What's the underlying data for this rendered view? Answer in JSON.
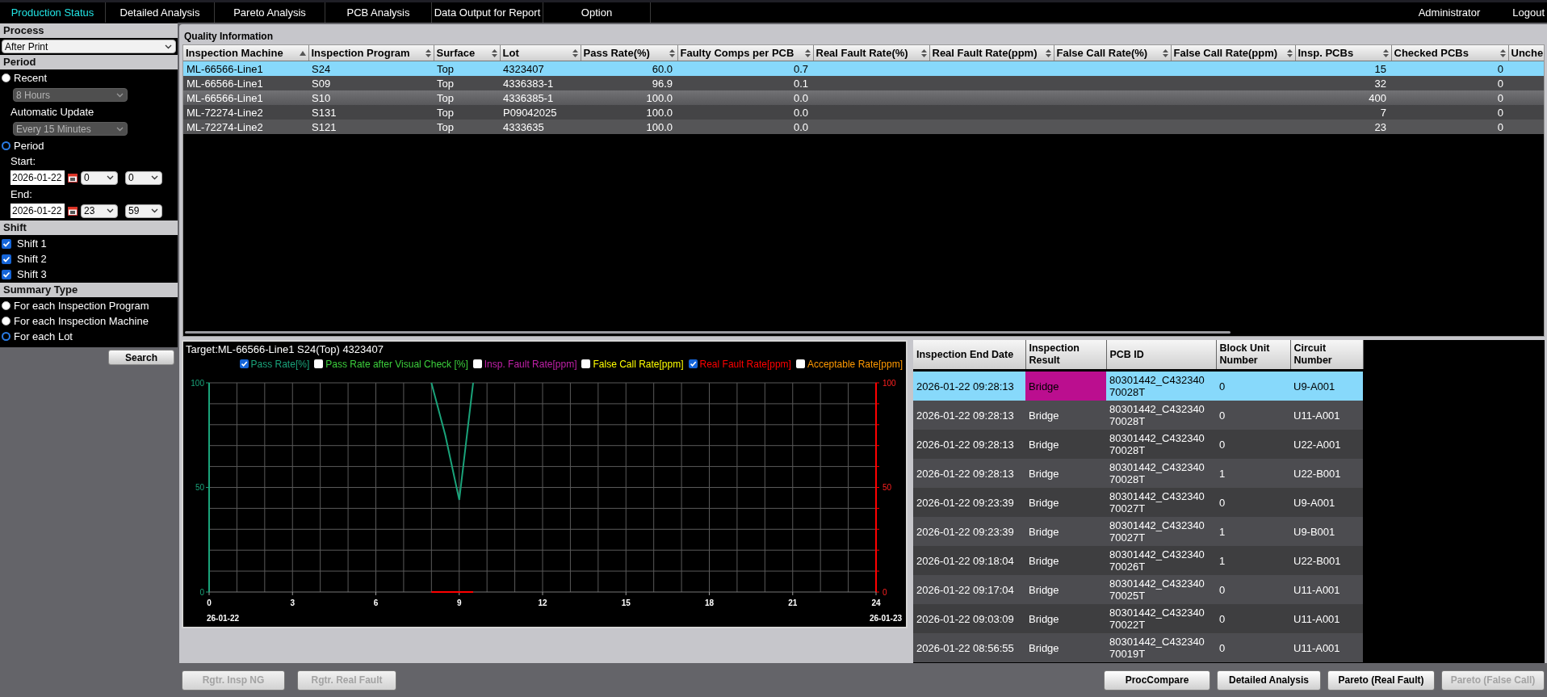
{
  "nav": {
    "tabs": [
      {
        "label": "Production Status",
        "selected": true
      },
      {
        "label": "Detailed Analysis",
        "selected": false
      },
      {
        "label": "Pareto Analysis",
        "selected": false
      },
      {
        "label": "PCB Analysis",
        "selected": false
      },
      {
        "label": "Data Output for Report",
        "selected": false
      },
      {
        "label": "Option",
        "selected": false
      }
    ],
    "user": "Administrator",
    "logout": "Logout"
  },
  "sidebar": {
    "process": {
      "heading": "Process",
      "value": "After Print"
    },
    "period": {
      "heading": "Period",
      "recent": {
        "label": "Recent",
        "selected": false,
        "range": {
          "value": "8 Hours",
          "disabled": true
        },
        "update_label": "Automatic Update",
        "update": {
          "value": "Every 15 Minutes",
          "disabled": true
        }
      },
      "custom": {
        "label": "Period",
        "selected": true,
        "start_label": "Start:",
        "start": {
          "date": "2026-01-22",
          "hour": "0",
          "minute": "0"
        },
        "end_label": "End:",
        "end": {
          "date": "2026-01-22",
          "hour": "23",
          "minute": "59"
        }
      }
    },
    "shift": {
      "heading": "Shift",
      "items": [
        {
          "label": "Shift 1",
          "checked": true
        },
        {
          "label": "Shift 2",
          "checked": true
        },
        {
          "label": "Shift 3",
          "checked": true
        }
      ]
    },
    "summary_type": {
      "heading": "Summary Type",
      "options": [
        {
          "label": "For each Inspection Program",
          "selected": false
        },
        {
          "label": "For each Inspection Machine",
          "selected": false
        },
        {
          "label": "For each Lot",
          "selected": true
        }
      ]
    },
    "search_button": "Search"
  },
  "quality": {
    "title": "Quality Information",
    "columns": [
      {
        "label": "Inspection Machine",
        "sorted": true
      },
      {
        "label": "Inspection Program",
        "sorted": false
      },
      {
        "label": "Surface",
        "sorted": false
      },
      {
        "label": "Lot",
        "sorted": false
      },
      {
        "label": "Pass Rate(%)",
        "sorted": false
      },
      {
        "label": "Faulty Comps per PCB",
        "sorted": false
      },
      {
        "label": "Real Fault Rate(%)",
        "sorted": false
      },
      {
        "label": "Real Fault Rate(ppm)",
        "sorted": false
      },
      {
        "label": "False Call Rate(%)",
        "sorted": false
      },
      {
        "label": "False Call Rate(ppm)",
        "sorted": false
      },
      {
        "label": "Insp. PCBs",
        "sorted": false
      },
      {
        "label": "Checked PCBs",
        "sorted": false
      },
      {
        "label": "Unche"
      }
    ],
    "rows": [
      {
        "selected": true,
        "cells": [
          "ML-66566-Line1",
          "S24",
          "Top",
          "4323407",
          "60.0",
          "0.7",
          null,
          null,
          null,
          null,
          "15",
          "0",
          null
        ]
      },
      {
        "selected": false,
        "cells": [
          "ML-66566-Line1",
          "S09",
          "Top",
          "4336383-1",
          "96.9",
          "0.1",
          null,
          null,
          null,
          null,
          "32",
          "0",
          null
        ]
      },
      {
        "selected": false,
        "cells": [
          "ML-66566-Line1",
          "S10",
          "Top",
          "4336385-1",
          "100.0",
          "0.0",
          null,
          null,
          null,
          null,
          "400",
          "0",
          null
        ]
      },
      {
        "selected": false,
        "cells": [
          "ML-72274-Line2",
          "S131",
          "Top",
          "P09042025",
          "100.0",
          "0.0",
          null,
          null,
          null,
          null,
          "7",
          "0",
          null
        ]
      },
      {
        "selected": false,
        "cells": [
          "ML-72274-Line2",
          "S121",
          "Top",
          "4333635",
          "100.0",
          "0.0",
          null,
          null,
          null,
          null,
          "23",
          "0",
          null
        ]
      }
    ]
  },
  "chart": {
    "title": "Target:ML-66566-Line1 S24(Top) 4323407",
    "legend": [
      {
        "label": "Pass Rate[%]",
        "checked": true,
        "color": "#1aa37a"
      },
      {
        "label": "Pass Rate after Visual Check [%]",
        "checked": false,
        "color": "#3ccf3c"
      },
      {
        "label": "Insp. Fault Rate[ppm]",
        "checked": false,
        "color": "#c020a8"
      },
      {
        "label": "False Call Rate[ppm]",
        "checked": false,
        "color": "#ffff00"
      },
      {
        "label": "Real Fault Rate[ppm]",
        "checked": true,
        "color": "#ff0000"
      },
      {
        "label": "Acceptable Rate[ppm]",
        "checked": false,
        "color": "#ff9900"
      }
    ],
    "start_date": "26-01-22",
    "end_date": "26-01-23",
    "chart_data": {
      "type": "line",
      "x": [
        8,
        8.5,
        9,
        9.5
      ],
      "series": [
        {
          "color": "#1aa37a",
          "values": [
            100,
            75,
            44,
            100
          ]
        },
        {
          "color": "#ff0000",
          "values": [
            0,
            0,
            0,
            0
          ]
        }
      ],
      "xlim": [
        0,
        24
      ],
      "ylim": [
        0,
        100
      ],
      "y2lim": [
        0,
        100
      ],
      "grid": true,
      "xticks": [
        0,
        3,
        6,
        9,
        12,
        15,
        18,
        21,
        24
      ],
      "yticks": [
        0,
        50,
        100
      ],
      "y2ticks": [
        0,
        50,
        100
      ]
    }
  },
  "defects": {
    "columns": [
      "Inspection End Date",
      "Inspection Result",
      "PCB ID",
      "Block Unit Number",
      "Circuit Number"
    ],
    "rows": [
      {
        "selected": true,
        "date": "2026-01-22 09:28:13",
        "result": "Bridge",
        "pcb_id": "80301442_C43234070028T",
        "block": "0",
        "circuit": "U9-A001"
      },
      {
        "selected": false,
        "date": "2026-01-22 09:28:13",
        "result": "Bridge",
        "pcb_id": "80301442_C43234070028T",
        "block": "0",
        "circuit": "U11-A001"
      },
      {
        "selected": false,
        "date": "2026-01-22 09:28:13",
        "result": "Bridge",
        "pcb_id": "80301442_C43234070028T",
        "block": "0",
        "circuit": "U22-A001"
      },
      {
        "selected": false,
        "date": "2026-01-22 09:28:13",
        "result": "Bridge",
        "pcb_id": "80301442_C43234070028T",
        "block": "1",
        "circuit": "U22-B001"
      },
      {
        "selected": false,
        "date": "2026-01-22 09:23:39",
        "result": "Bridge",
        "pcb_id": "80301442_C43234070027T",
        "block": "0",
        "circuit": "U9-A001"
      },
      {
        "selected": false,
        "date": "2026-01-22 09:23:39",
        "result": "Bridge",
        "pcb_id": "80301442_C43234070027T",
        "block": "1",
        "circuit": "U9-B001"
      },
      {
        "selected": false,
        "date": "2026-01-22 09:18:04",
        "result": "Bridge",
        "pcb_id": "80301442_C43234070026T",
        "block": "1",
        "circuit": "U22-B001"
      },
      {
        "selected": false,
        "date": "2026-01-22 09:17:04",
        "result": "Bridge",
        "pcb_id": "80301442_C43234070025T",
        "block": "0",
        "circuit": "U11-A001"
      },
      {
        "selected": false,
        "date": "2026-01-22 09:03:09",
        "result": "Bridge",
        "pcb_id": "80301442_C43234070022T",
        "block": "0",
        "circuit": "U11-A001"
      },
      {
        "selected": false,
        "date": "2026-01-22 08:56:55",
        "result": "Bridge",
        "pcb_id": "80301442_C43234070019T",
        "block": "0",
        "circuit": "U11-A001"
      }
    ]
  },
  "actions": {
    "left": [
      {
        "label": "Rgtr. Insp NG",
        "disabled": true
      },
      {
        "label": "Rgtr. Real Fault",
        "disabled": true
      }
    ],
    "right": [
      {
        "label": "ProcCompare",
        "disabled": false
      },
      {
        "label": "Detailed Analysis",
        "disabled": false
      },
      {
        "label": "Pareto (Real Fault)",
        "disabled": false
      },
      {
        "label": "Pareto (False Call)",
        "disabled": true
      }
    ]
  }
}
